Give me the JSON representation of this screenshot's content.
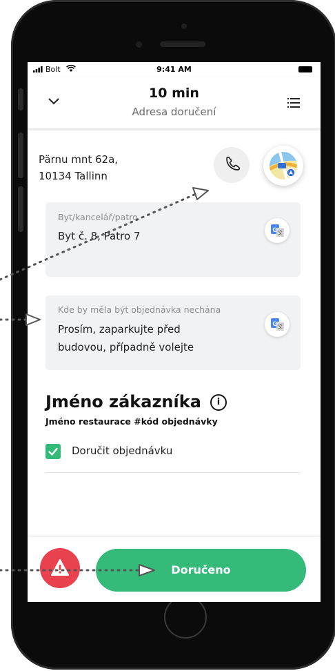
{
  "status_bar": {
    "carrier": "Bolt",
    "time": "9:41 AM"
  },
  "header": {
    "title": "10 min",
    "subtitle": "Adresa doručení"
  },
  "address": {
    "line1": "Pärnu mnt 62a,",
    "line2": "10134 Tallinn"
  },
  "apartment": {
    "label": "Byt/kancelář/patro",
    "value": "Byt č. 8, Patro 7"
  },
  "instructions": {
    "label": "Kde by měla být objednávka nechána",
    "line1": "Prosím, zaparkujte před",
    "line2": "budovou, případně volejte"
  },
  "customer": {
    "name": "Jméno zákazníka",
    "subtitle": "Jméno restaurace #kód objednávky",
    "checkbox_label": "Doručit objednávku",
    "checkbox_checked": true
  },
  "footer": {
    "delivered_label": "Doručeno"
  },
  "icons": {
    "call": "phone-icon",
    "maps": "maps-icon",
    "translate": "translate-icon",
    "alert": "warning-icon",
    "info": "info-icon",
    "menu": "list-icon",
    "collapse": "chevron-down-icon"
  },
  "colors": {
    "accent_green": "#34ba79",
    "alert_red": "#e8424f",
    "card_bg": "#f1f2f4"
  }
}
